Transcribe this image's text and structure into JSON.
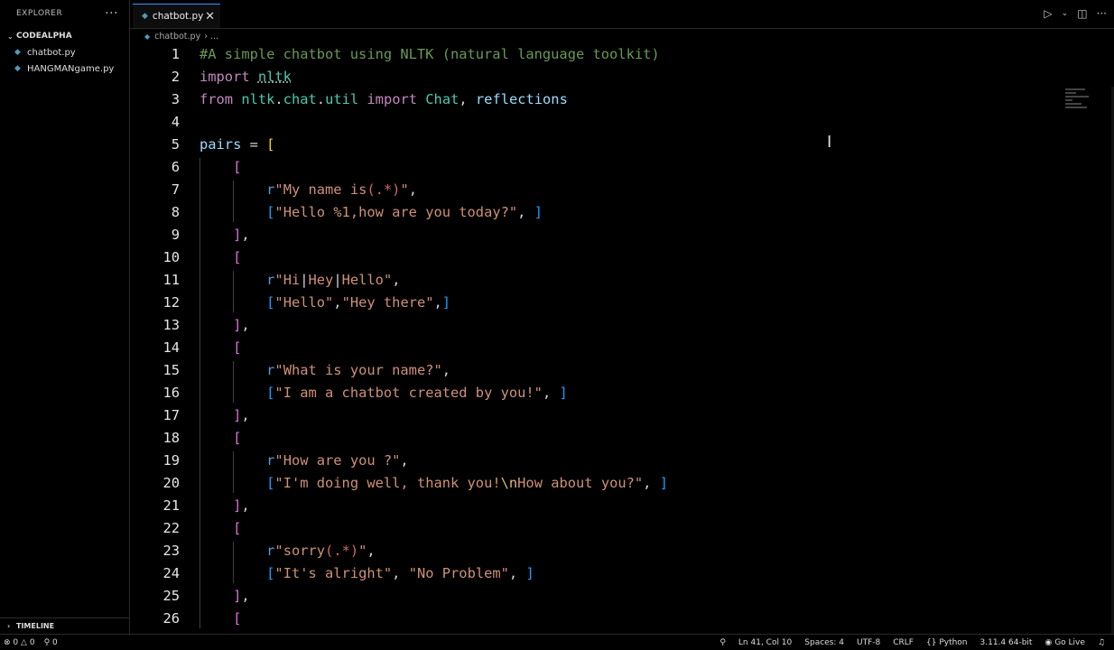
{
  "sidebar": {
    "title": "EXPLORER",
    "more_icon": "ellipsis-icon",
    "folder": "CODEALPHA",
    "files": [
      "chatbot.py",
      "HANGMANgame.py"
    ],
    "timeline": "TIMELINE"
  },
  "tab": {
    "label": "chatbot.py",
    "close": "✕"
  },
  "breadcrumb": {
    "file": "chatbot.py",
    "rest": "› ..."
  },
  "status": {
    "errors": "0",
    "warnings": "0",
    "ports": "0",
    "position": "Ln 41, Col 10",
    "spaces": "Spaces: 4",
    "encoding": "UTF-8",
    "eol": "CRLF",
    "language": "Python",
    "interpreter": "3.11.4 64-bit",
    "golive": "Go Live"
  },
  "code_lines": [
    [
      [
        "cm",
        "#A simple chatbot using NLTK (natural language toolkit)"
      ]
    ],
    [
      [
        "kw",
        "import "
      ],
      [
        "mod",
        "nltk"
      ]
    ],
    [
      [
        "kw",
        "from "
      ],
      [
        "mod",
        "nltk"
      ],
      [
        "pun",
        "."
      ],
      [
        "mod",
        "chat"
      ],
      [
        "pun",
        "."
      ],
      [
        "mod",
        "util"
      ],
      [
        "kw",
        " import "
      ],
      [
        "cls",
        "Chat"
      ],
      [
        "pun",
        ", "
      ],
      [
        "var",
        "reflections"
      ]
    ],
    [],
    [
      [
        "var",
        "pairs"
      ],
      [
        "pun",
        " = "
      ],
      [
        "b1",
        "["
      ]
    ],
    [
      [
        "pun",
        "    "
      ],
      [
        "b2",
        "["
      ]
    ],
    [
      [
        "pun",
        "        "
      ],
      [
        "pre",
        "r"
      ],
      [
        "str",
        "\"My name is"
      ],
      [
        "rg",
        "(.*)"
      ],
      [
        "str",
        "\""
      ],
      [
        "pun",
        ","
      ]
    ],
    [
      [
        "pun",
        "        "
      ],
      [
        "b3",
        "["
      ],
      [
        "str",
        "\"Hello %1,how are you today?\""
      ],
      [
        "pun",
        ", "
      ],
      [
        "b3",
        "]"
      ]
    ],
    [
      [
        "pun",
        "    "
      ],
      [
        "b2",
        "]"
      ],
      [
        "pun",
        ","
      ]
    ],
    [
      [
        "pun",
        "    "
      ],
      [
        "b2",
        "["
      ]
    ],
    [
      [
        "pun",
        "        "
      ],
      [
        "pre",
        "r"
      ],
      [
        "str",
        "\"Hi"
      ],
      [
        "pun",
        "|"
      ],
      [
        "str",
        "Hey"
      ],
      [
        "pun",
        "|"
      ],
      [
        "str",
        "Hello\""
      ],
      [
        "pun",
        ","
      ]
    ],
    [
      [
        "pun",
        "        "
      ],
      [
        "b3",
        "["
      ],
      [
        "str",
        "\"Hello\""
      ],
      [
        "pun",
        ","
      ],
      [
        "str",
        "\"Hey there\""
      ],
      [
        "pun",
        ","
      ],
      [
        "b3",
        "]"
      ]
    ],
    [
      [
        "pun",
        "    "
      ],
      [
        "b2",
        "]"
      ],
      [
        "pun",
        ","
      ]
    ],
    [
      [
        "pun",
        "    "
      ],
      [
        "b2",
        "["
      ]
    ],
    [
      [
        "pun",
        "        "
      ],
      [
        "pre",
        "r"
      ],
      [
        "str",
        "\"What is your name?\""
      ],
      [
        "pun",
        ","
      ]
    ],
    [
      [
        "pun",
        "        "
      ],
      [
        "b3",
        "["
      ],
      [
        "str",
        "\"I am a chatbot created by you!\""
      ],
      [
        "pun",
        ", "
      ],
      [
        "b3",
        "]"
      ]
    ],
    [
      [
        "pun",
        "    "
      ],
      [
        "b2",
        "]"
      ],
      [
        "pun",
        ","
      ]
    ],
    [
      [
        "pun",
        "    "
      ],
      [
        "b2",
        "["
      ]
    ],
    [
      [
        "pun",
        "        "
      ],
      [
        "pre",
        "r"
      ],
      [
        "str",
        "\"How are you ?\""
      ],
      [
        "pun",
        ","
      ]
    ],
    [
      [
        "pun",
        "        "
      ],
      [
        "b3",
        "["
      ],
      [
        "str",
        "\"I'm doing well, thank you!"
      ],
      [
        "esc",
        "\\n"
      ],
      [
        "str",
        "How about you?\""
      ],
      [
        "pun",
        ", "
      ],
      [
        "b3",
        "]"
      ]
    ],
    [
      [
        "pun",
        "    "
      ],
      [
        "b2",
        "]"
      ],
      [
        "pun",
        ","
      ]
    ],
    [
      [
        "pun",
        "    "
      ],
      [
        "b2",
        "["
      ]
    ],
    [
      [
        "pun",
        "        "
      ],
      [
        "pre",
        "r"
      ],
      [
        "str",
        "\"sorry"
      ],
      [
        "rg",
        "(.*)"
      ],
      [
        "str",
        "\""
      ],
      [
        "pun",
        ","
      ]
    ],
    [
      [
        "pun",
        "        "
      ],
      [
        "b3",
        "["
      ],
      [
        "str",
        "\"It's alright\""
      ],
      [
        "pun",
        ", "
      ],
      [
        "str",
        "\"No Problem\""
      ],
      [
        "pun",
        ", "
      ],
      [
        "b3",
        "]"
      ]
    ],
    [
      [
        "pun",
        "    "
      ],
      [
        "b2",
        "]"
      ],
      [
        "pun",
        ","
      ]
    ],
    [
      [
        "pun",
        "    "
      ],
      [
        "b2",
        "["
      ]
    ]
  ]
}
